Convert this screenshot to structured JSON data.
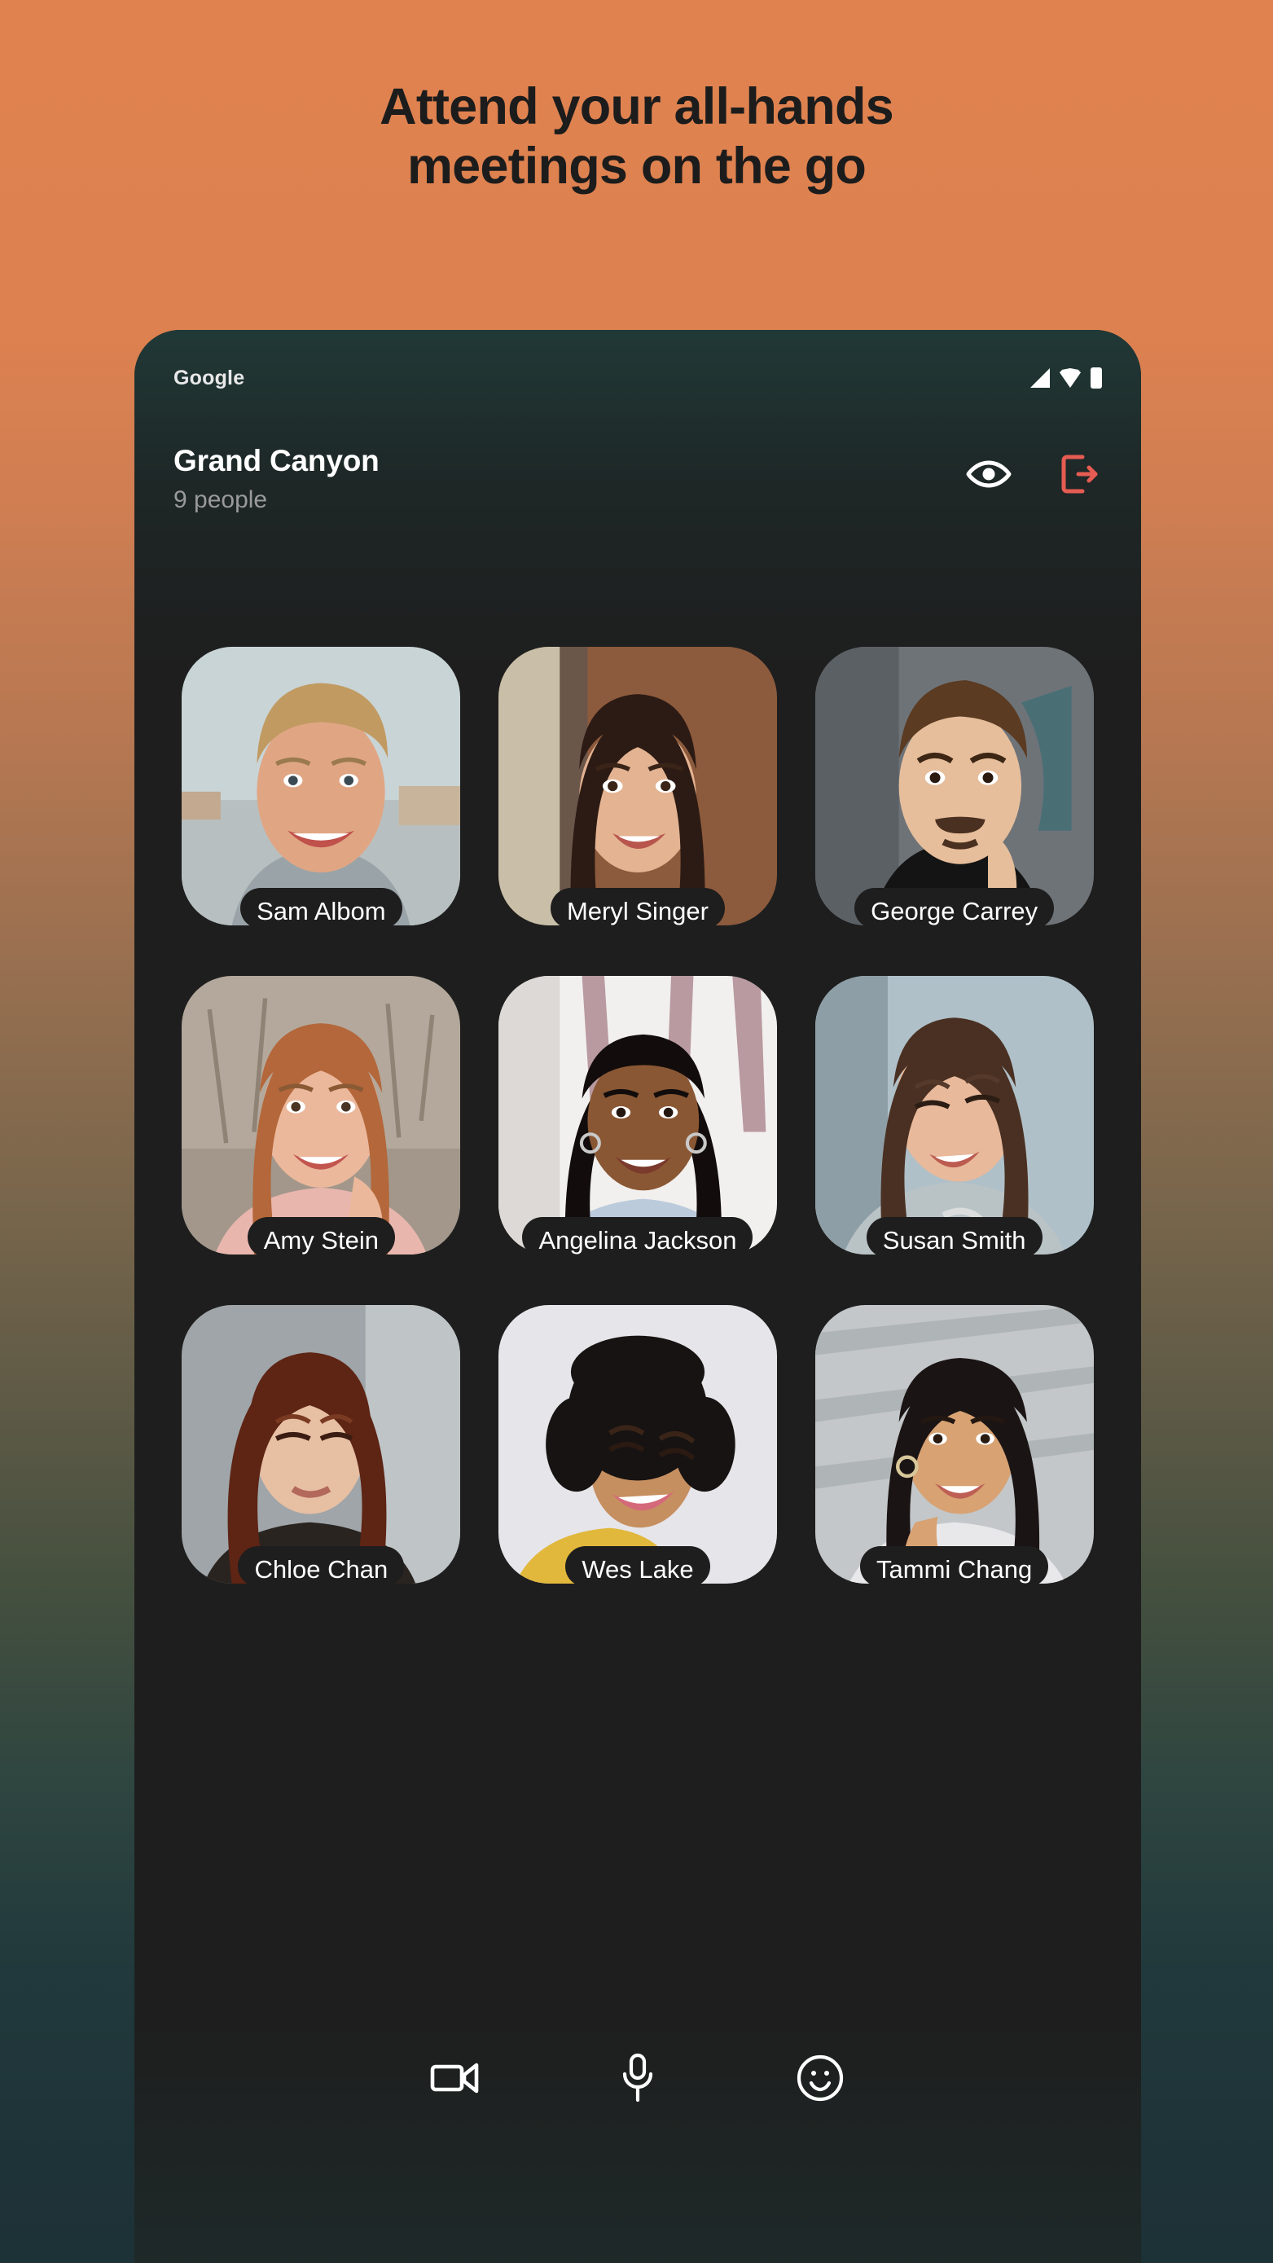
{
  "promo": {
    "headline_line1": "Attend your all-hands",
    "headline_line2": "meetings on the go",
    "background_top_color": "#DE8150",
    "background_bottom_color": "#1D3236"
  },
  "phone": {
    "status_bar": {
      "carrier": "Google",
      "icons": [
        "signal-icon",
        "wifi-icon",
        "battery-icon"
      ]
    },
    "meeting": {
      "title": "Grand Canyon",
      "subtitle": "9 people",
      "actions": [
        {
          "name": "eye-icon",
          "label": "View",
          "color": "#FFFFFF"
        },
        {
          "name": "leave-icon",
          "label": "Leave meeting",
          "color": "#E65C52"
        }
      ]
    },
    "participants": [
      {
        "name": "Sam Albom",
        "bg": "#C9D4D6",
        "skin": "#E0A684",
        "hair": "#C19A62",
        "shirt": "#9AA4A8"
      },
      {
        "name": "Meryl Singer",
        "bg": "#8C5A3C",
        "skin": "#E4B392",
        "hair": "#2C1B14",
        "shirt": "#3A2418"
      },
      {
        "name": "George Carrey",
        "bg": "#6E7378",
        "skin": "#E6BE9B",
        "hair": "#5B3B22",
        "shirt": "#141414"
      },
      {
        "name": "Amy Stein",
        "bg": "#B3A89B",
        "skin": "#EBB89C",
        "hair": "#B4673A",
        "shirt": "#E9B6AE"
      },
      {
        "name": "Angelina Jackson",
        "bg": "#E7E4E2",
        "skin": "#8A5734",
        "hair": "#120D0C",
        "shirt": "#BCCBDC"
      },
      {
        "name": "Susan Smith",
        "bg": "#AFC0C8",
        "skin": "#E8B99B",
        "hair": "#4A3022",
        "shirt": "#B9C3C6"
      },
      {
        "name": "Chloe Chan",
        "bg": "#9FA5A8",
        "skin": "#E7BFA3",
        "hair": "#5E2414",
        "shirt": "#2A2421"
      },
      {
        "name": "Wes Lake",
        "bg": "#E6E5E9",
        "skin": "#C68F60",
        "hair": "#171312",
        "shirt": "#E2B83C"
      },
      {
        "name": "Tammi Chang",
        "bg": "#C3C7C9",
        "skin": "#D8A273",
        "hair": "#1B1414",
        "shirt": "#E8E8EA"
      }
    ],
    "controls": [
      {
        "name": "video-camera-icon",
        "label": "Camera"
      },
      {
        "name": "microphone-icon",
        "label": "Microphone"
      },
      {
        "name": "smiley-icon",
        "label": "Reactions"
      }
    ]
  }
}
